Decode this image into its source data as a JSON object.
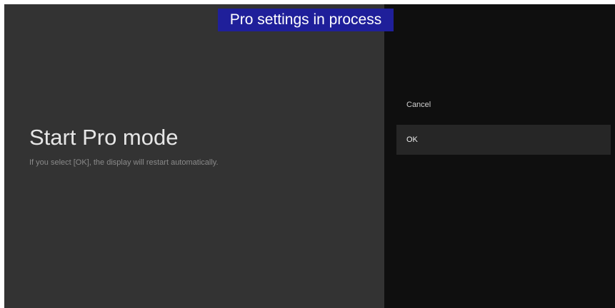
{
  "banner": {
    "text": "Pro settings in process",
    "background_color": "#1f1f9a"
  },
  "dialog": {
    "title": "Start Pro mode",
    "description": "If you select [OK], the display will restart automatically."
  },
  "options": {
    "cancel_label": "Cancel",
    "ok_label": "OK",
    "focused": "OK"
  }
}
